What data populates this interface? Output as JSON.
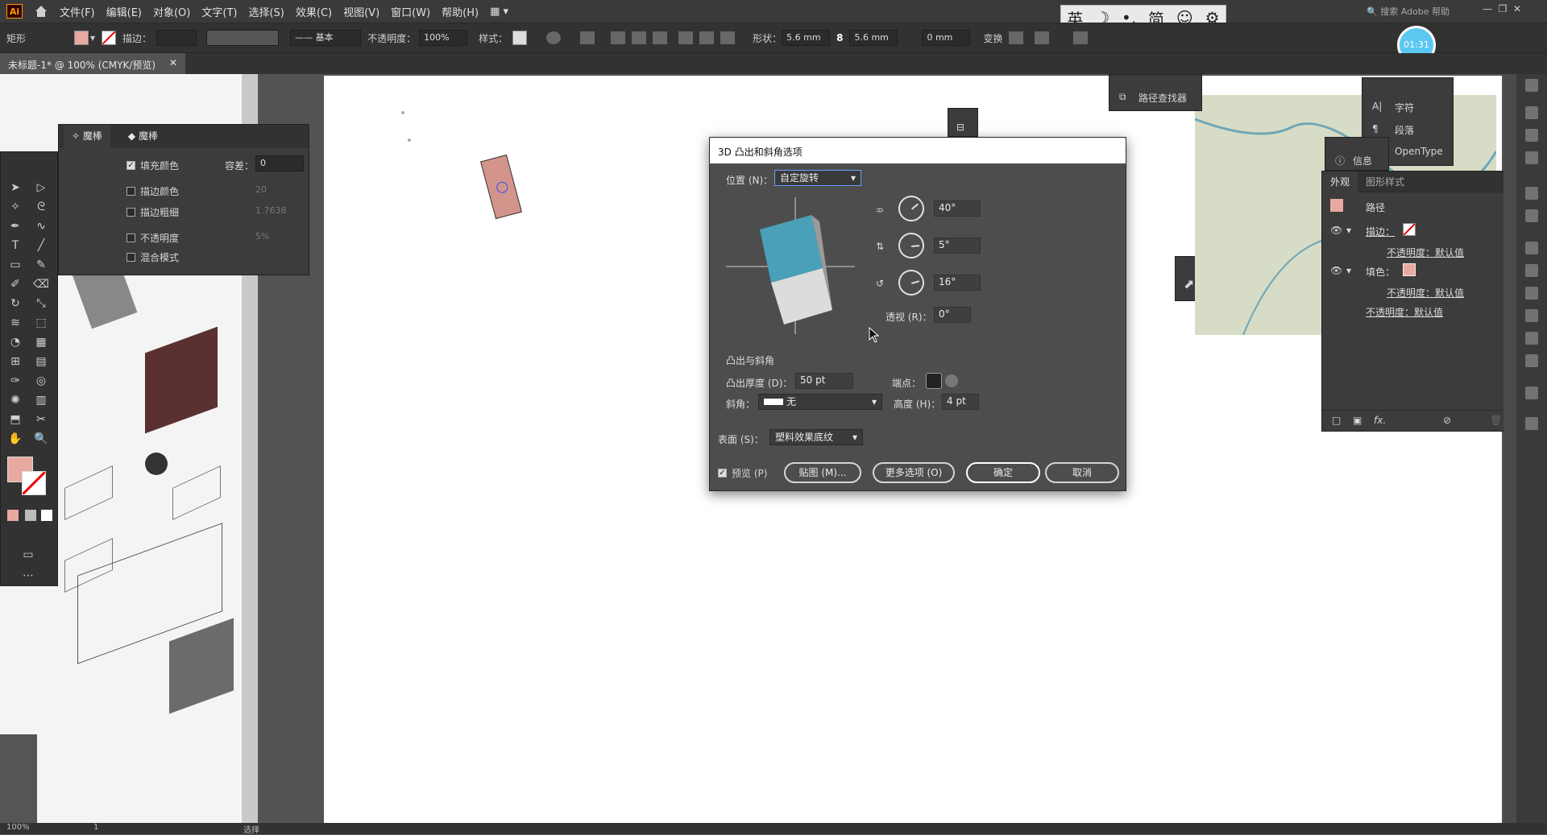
{
  "menubar": {
    "logo": "Ai",
    "items": [
      "文件(F)",
      "编辑(E)",
      "对象(O)",
      "文字(T)",
      "选择(S)",
      "效果(C)",
      "视图(V)",
      "窗口(W)",
      "帮助(H)"
    ],
    "search_placeholder": "搜索 Adobe 帮助"
  },
  "ime_bar": {
    "items": [
      "英",
      "☽",
      "•,",
      "简",
      "☺",
      "⚙"
    ]
  },
  "timer": {
    "text": "01:31"
  },
  "controlbar": {
    "object_type": "矩形",
    "stroke_label": "描边：",
    "stroke_profile": "基本",
    "opacity_label": "不透明度：",
    "opacity_value": "100%",
    "style_label": "样式：",
    "shape_label": "形状：",
    "width_value": "5.6 mm",
    "height_value": "5.6 mm",
    "corner_value": "0 mm",
    "transform_label": "变换"
  },
  "document": {
    "tab_title": "未标题-1* @ 100% (CMYK/预览)"
  },
  "wand_panel": {
    "tab": "魔棒",
    "tolerance_label": "容差：",
    "rows": [
      {
        "label": "填充颜色",
        "checked": true,
        "value": "0"
      },
      {
        "label": "描边颜色",
        "checked": false,
        "value": "20"
      },
      {
        "label": "描边粗细",
        "checked": false,
        "value": "1.7638"
      },
      {
        "label": "不透明度",
        "checked": false,
        "value": "5%"
      },
      {
        "label": "混合模式",
        "checked": false,
        "value": ""
      }
    ]
  },
  "dialog": {
    "title": "3D 凸出和斜角选项",
    "position_label": "位置 (N)：",
    "position_value": "自定旋转",
    "angle_x": "40°",
    "angle_y": "5°",
    "angle_z": "16°",
    "perspective_label": "透视 (R)：",
    "perspective_value": "0°",
    "extrude_section": "凸出与斜角",
    "extrude_depth_label": "凸出厚度 (D)：",
    "extrude_depth_value": "50 pt",
    "cap_label": "端点：",
    "bevel_label": "斜角：",
    "bevel_value": "无",
    "height_label": "高度 (H)：",
    "height_value": "4 pt",
    "surface_label": "表面 (S)：",
    "surface_value": "塑料效果底纹",
    "preview_label": "预览 (P)",
    "preview_checked": true,
    "buttons": {
      "map": "贴图 (M)...",
      "more": "更多选项 (O)",
      "ok": "确定",
      "cancel": "取消"
    }
  },
  "pathfinder_panel": {
    "title": "路径查找器"
  },
  "char_panel": {
    "items": [
      "字符",
      "段落",
      "OpenType"
    ]
  },
  "info_panel": {
    "title": "信息"
  },
  "appearance_panel": {
    "tabs": [
      "外观",
      "图形样式"
    ],
    "object": "路径",
    "rows": [
      {
        "label": "描边：",
        "kind": "stroke"
      },
      {
        "label": "不透明度：默认值",
        "kind": "sub"
      },
      {
        "label": "填色：",
        "kind": "fill"
      },
      {
        "label": "不透明度：默认值",
        "kind": "sub"
      },
      {
        "label": "不透明度：默认值",
        "kind": "top"
      }
    ]
  },
  "statusbar": {
    "zoom": "100%",
    "page": "1",
    "tool": "选择"
  },
  "colors": {
    "fill": "#e8a9a0",
    "cube_top": "#4aa0b8",
    "cube_side": "#dcdcdc",
    "ui_dark": "#323232",
    "accent": "#5bc8f0"
  }
}
